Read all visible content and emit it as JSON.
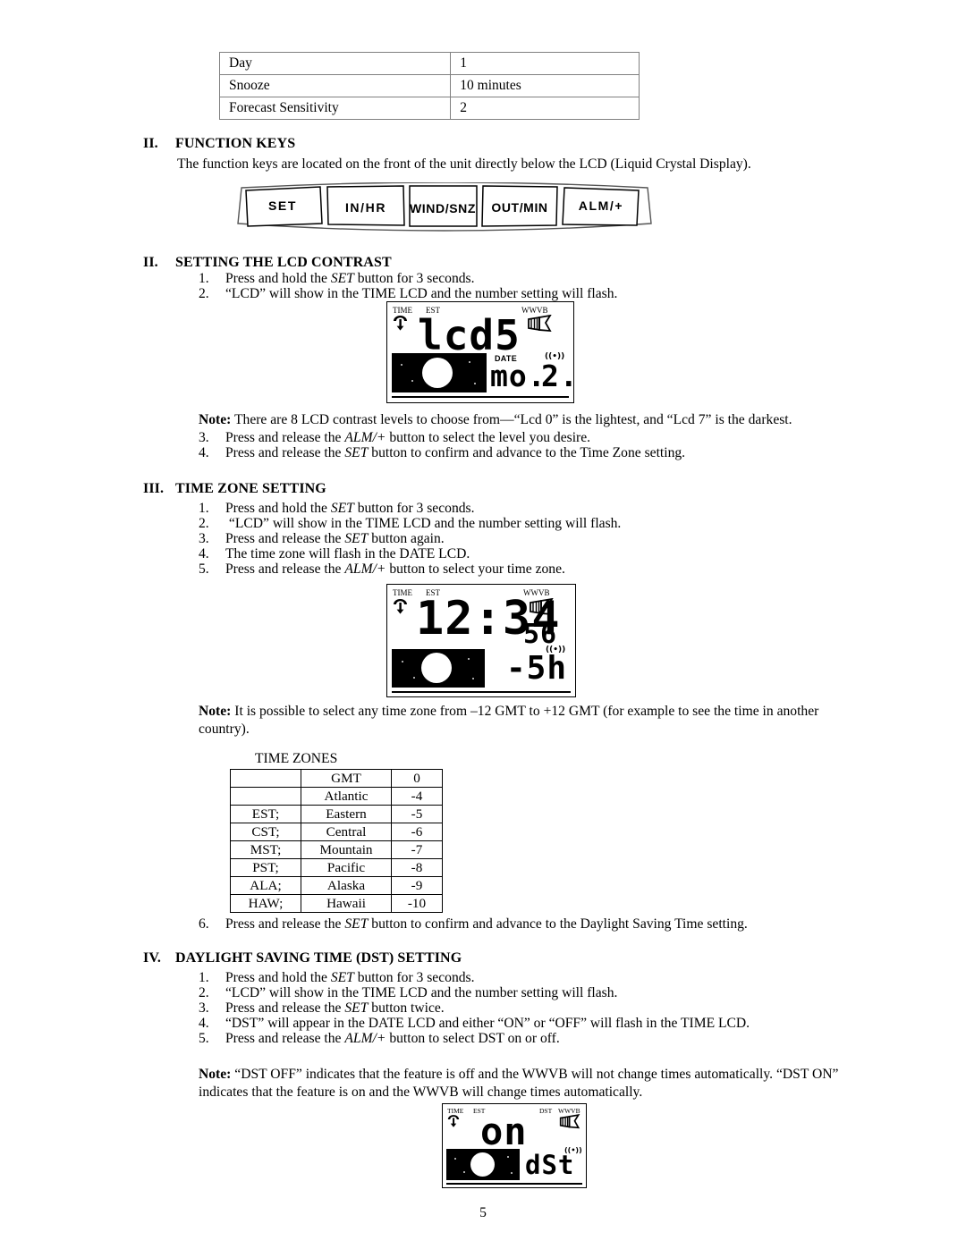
{
  "settings_table": {
    "rows": [
      {
        "label": "Day",
        "value": "1"
      },
      {
        "label": "Snooze",
        "value": "10 minutes"
      },
      {
        "label": "Forecast Sensitivity",
        "value": "2"
      }
    ]
  },
  "section_function_keys": {
    "numeral": "II.",
    "title": "FUNCTION KEYS",
    "intro": "The function keys are located on the front of the unit directly below the LCD (Liquid Crystal Display).",
    "keys": [
      "SET",
      "IN/HR",
      "WIND/SNZ",
      "OUT/MIN",
      "ALM/+"
    ]
  },
  "section_lcd_contrast": {
    "numeral": "II.",
    "title": "SETTING THE LCD CONTRAST",
    "steps": [
      {
        "marker": "1.",
        "pre": "Press and hold the ",
        "em": "SET",
        "post": " button for 3 seconds."
      },
      {
        "marker": "2.",
        "pre": "“LCD” will show in the TIME LCD and the number setting will flash.",
        "em": "",
        "post": ""
      },
      {
        "marker": "3.",
        "pre": "Press and release the ",
        "em": "ALM/+",
        "post": " button to select the level you desire."
      },
      {
        "marker": "4.",
        "pre": "Press and release the ",
        "em": "SET",
        "post": " button to confirm and advance to the Time Zone setting."
      }
    ],
    "note_label": "Note:",
    "note_text": " There are 8 LCD contrast levels to choose from—“Lcd 0” is the lightest, and “Lcd 7” is the darkest."
  },
  "lcd_contrast_display": {
    "tag_time": "TIME",
    "tag_est": "EST",
    "tag_wwvb": "WWVB",
    "time_value": "lcd5",
    "date_label": "DATE",
    "date_value": "mo.",
    "extra_value": "2.",
    "alarm_icon": "((•))",
    "antenna_icon": "antenna-icon"
  },
  "section_time_zone": {
    "numeral": "III.",
    "title": "TIME ZONE SETTING",
    "steps": [
      {
        "marker": "1.",
        "pre": "Press and hold the ",
        "em": "SET",
        "post": " button for 3 seconds."
      },
      {
        "marker": "2.",
        "pre": " “LCD” will show in the TIME LCD and the number setting will flash.",
        "em": "",
        "post": ""
      },
      {
        "marker": "3.",
        "pre": "Press and release the ",
        "em": "SET",
        "post": " button again."
      },
      {
        "marker": "4.",
        "pre": "The time zone will flash in the DATE LCD.",
        "em": "",
        "post": ""
      },
      {
        "marker": "5.",
        "pre": "Press and release the ",
        "em": "ALM/+",
        "post": " button to select your time zone."
      }
    ],
    "note_label": "Note:",
    "note_text": "  It is possible to select any time zone from –12 GMT to +12 GMT (for example to see the time in another country).",
    "step6": {
      "marker": "6.",
      "pre": "Press and release the ",
      "em": "SET",
      "post": " button to confirm and advance to the Daylight Saving Time setting."
    }
  },
  "lcd_timezone_display": {
    "tag_time": "TIME",
    "tag_est": "EST",
    "tag_wwvb": "WWVB",
    "time_value": "12:34",
    "seconds_value": "56",
    "zone_value": "-5h",
    "alarm_icon": "((•))",
    "antenna_icon": "antenna-icon"
  },
  "time_zones": {
    "caption": "TIME ZONES",
    "rows": [
      {
        "abbr": "",
        "zone": "GMT",
        "offset": "0"
      },
      {
        "abbr": "",
        "zone": "Atlantic",
        "offset": "-4"
      },
      {
        "abbr": "EST;",
        "zone": "Eastern",
        "offset": "-5"
      },
      {
        "abbr": "CST;",
        "zone": "Central",
        "offset": "-6"
      },
      {
        "abbr": "MST;",
        "zone": "Mountain",
        "offset": "-7"
      },
      {
        "abbr": "PST;",
        "zone": "Pacific",
        "offset": "-8"
      },
      {
        "abbr": "ALA;",
        "zone": "Alaska",
        "offset": "-9"
      },
      {
        "abbr": "HAW;",
        "zone": "Hawaii",
        "offset": "-10"
      }
    ]
  },
  "section_dst": {
    "numeral": "IV.",
    "title": "DAYLIGHT SAVING TIME (DST) SETTING",
    "steps": [
      {
        "marker": "1.",
        "pre": "Press and hold the ",
        "em": "SET",
        "post": " button for 3 seconds."
      },
      {
        "marker": "2.",
        "pre": "“LCD” will show in the TIME LCD and the number setting will flash.",
        "em": "",
        "post": ""
      },
      {
        "marker": "3.",
        "pre": "Press and release the ",
        "em": "SET",
        "post": " button twice."
      },
      {
        "marker": "4.",
        "pre": "“DST” will appear in the DATE LCD and either “ON” or “OFF” will flash in the TIME LCD.",
        "em": "",
        "post": ""
      },
      {
        "marker": "5.",
        "pre": "Press and release the ",
        "em": "ALM/+",
        "post": " button to select DST on or off."
      }
    ],
    "note_label": "Note:",
    "note_text": "  “DST OFF” indicates that the feature is off and the WWVB will not change times automatically. “DST ON” indicates that the feature is on and the WWVB will change times automatically."
  },
  "lcd_dst_display": {
    "tag_time": "TIME",
    "tag_est": "EST",
    "tag_dst": "DST",
    "tag_wwvb": "WWVB",
    "time_value": "on",
    "date_value": "dSt",
    "alarm_icon": "((•))",
    "antenna_icon": "antenna-icon"
  },
  "footer": {
    "page_number": "5"
  },
  "colors": {
    "ink": "#000000",
    "paper": "#ffffff",
    "table_border_gray": "#808080"
  }
}
